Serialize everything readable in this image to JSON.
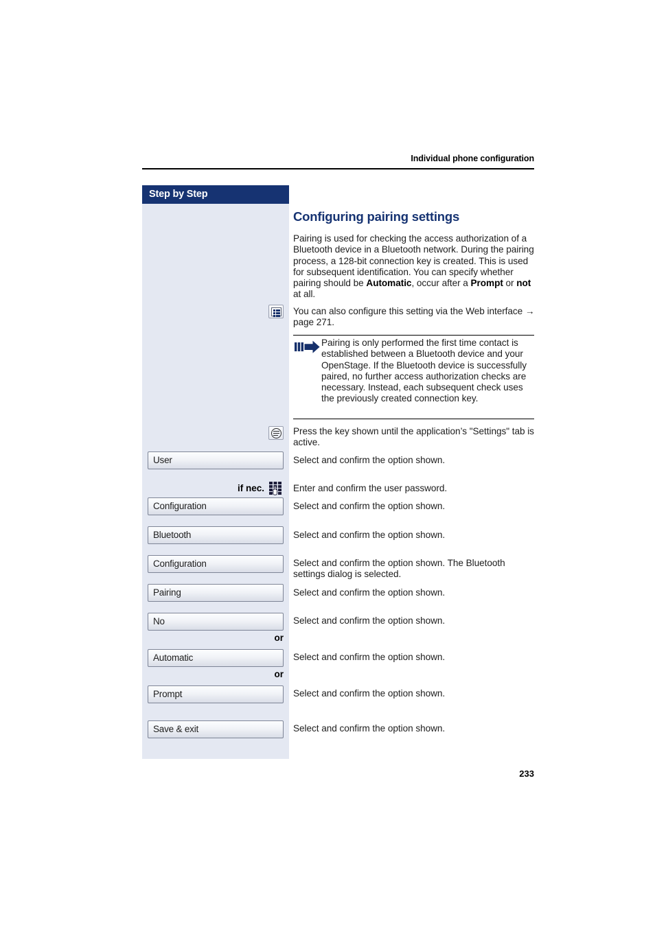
{
  "header": {
    "running_title": "Individual phone configuration"
  },
  "sidebar": {
    "title": "Step by Step",
    "or_label": "or",
    "if_nec_label": "if nec.",
    "keys": [
      {
        "label": "User"
      },
      {
        "label": "Configuration"
      },
      {
        "label": "Bluetooth"
      },
      {
        "label": "Configuration"
      },
      {
        "label": "Pairing"
      },
      {
        "label": "No"
      },
      {
        "label": "Automatic"
      },
      {
        "label": "Prompt"
      },
      {
        "label": "Save & exit"
      }
    ]
  },
  "main": {
    "heading": "Configuring pairing settings",
    "intro_para": {
      "t1": "Pairing is used for checking the access authorization of a Bluetooth device in a Bluetooth network. During the pairing process, a 128-bit connection key is created. This is used for subsequent identification. You can specify whether pairing should be ",
      "b1": "Automatic",
      "t2": ", occur after a ",
      "b2": "Prompt",
      "t3": " or ",
      "b3": "not",
      "t4": " at all."
    },
    "webui_note": "You can also configure this setting via the Web interface → page 271.",
    "note_box": {
      "text": "Pairing is only performed the first time contact is established between a Bluetooth device and your OpenStage. If the Bluetooth device is successfully paired, no further access authorization checks are necessary. Instead, each subsequent check uses the previously created connection key."
    },
    "instructions": [
      "Press the key shown until the application’s \"Settings\" tab is active.",
      "Select and confirm the option shown.",
      "Enter and confirm the user password.",
      "Select and confirm the option shown.",
      "Select and confirm the option shown.",
      "Select and confirm the option shown. The Bluetooth settings dialog is selected.",
      "Select and confirm the option shown.",
      "Select and confirm the option shown.",
      "Select and confirm the option shown.",
      "Select and confirm the option shown.",
      "Select and confirm the option shown."
    ]
  },
  "footer": {
    "page_number": "233"
  },
  "colors": {
    "brand_blue": "#163372",
    "sidebar_bg": "#e4e8f2",
    "text": "#1d1d1d"
  }
}
